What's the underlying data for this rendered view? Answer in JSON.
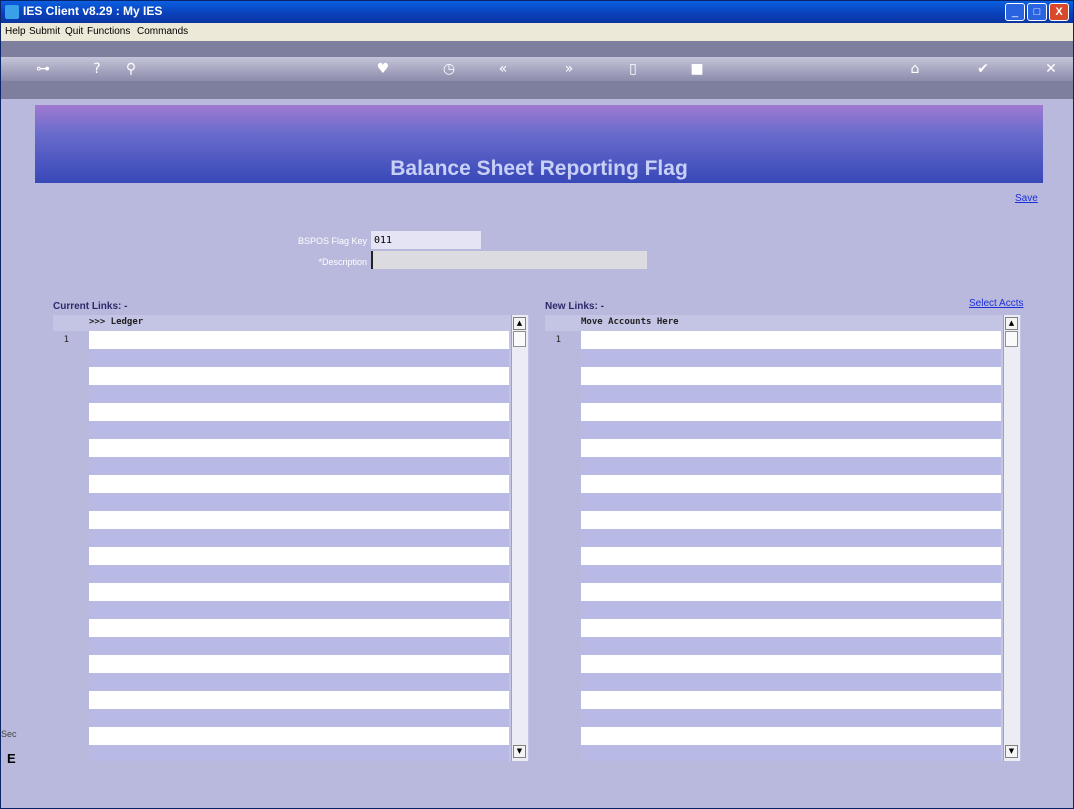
{
  "window": {
    "title": "IES Client v8.29 : My IES",
    "minimize": "_",
    "maximize": "□",
    "close": "X"
  },
  "menu": [
    "Help",
    "Submit",
    "Quit",
    "Functions",
    "Commands"
  ],
  "toolbar_icons": [
    "key-icon",
    "help-icon",
    "search-icon",
    "heart-icon",
    "clock-icon",
    "back-icon",
    "forward-icon",
    "tag-icon",
    "stop-icon",
    "home-icon",
    "check-icon",
    "close-icon"
  ],
  "banner": {
    "title": "Balance Sheet Reporting Flag"
  },
  "actions": {
    "save": "Save",
    "select_accts": "Select Accts"
  },
  "form": {
    "flag_key_label": "BSPOS Flag Key",
    "flag_key_value": "011",
    "description_label": "*Description",
    "description_value": ""
  },
  "current_links": {
    "label": "Current Links: -",
    "header": ">>> Ledger",
    "row_number": "1"
  },
  "new_links": {
    "label": "New Links: -",
    "header": "Move Accounts Here",
    "row_number": "1"
  },
  "scroll": {
    "up": "▲",
    "down": "▼"
  },
  "side": {
    "label": "Sec",
    "glyph": "E"
  }
}
